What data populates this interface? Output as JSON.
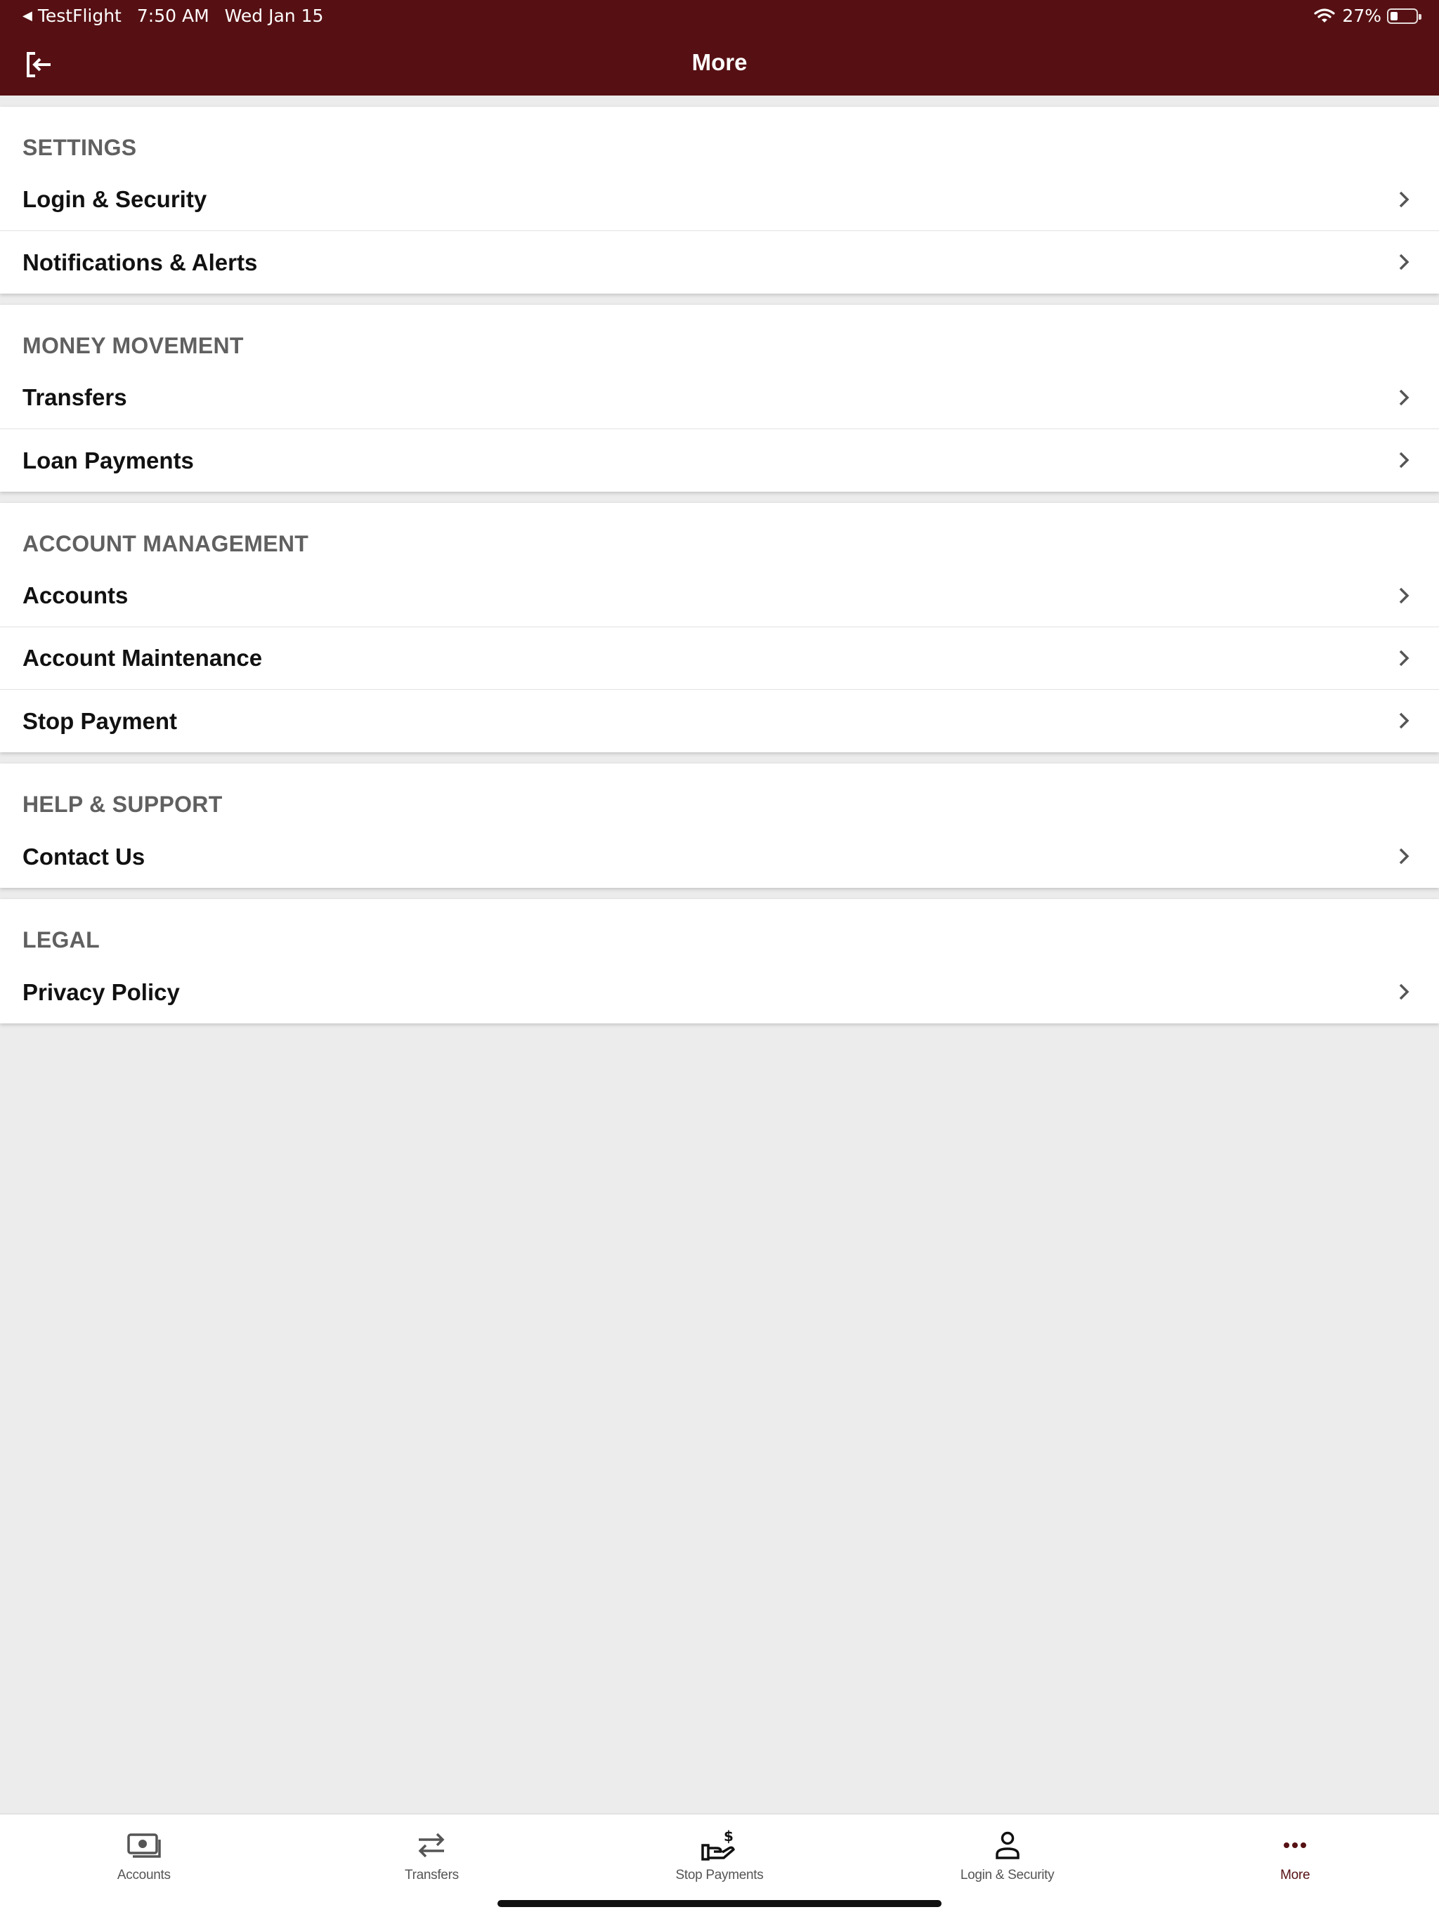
{
  "status_bar": {
    "back_app": "TestFlight",
    "time": "7:50 AM",
    "date": "Wed Jan 15",
    "battery_text": "27%",
    "battery_level": 0.27,
    "icons": [
      "back-triangle-icon",
      "wifi-icon",
      "battery-icon"
    ]
  },
  "nav": {
    "title": "More",
    "logout_icon": "logout-icon"
  },
  "sections": [
    {
      "header": "SETTINGS",
      "items": [
        {
          "label": "Login & Security"
        },
        {
          "label": "Notifications & Alerts"
        }
      ]
    },
    {
      "header": "MONEY MOVEMENT",
      "items": [
        {
          "label": "Transfers"
        },
        {
          "label": "Loan Payments"
        }
      ]
    },
    {
      "header": "ACCOUNT MANAGEMENT",
      "items": [
        {
          "label": "Accounts"
        },
        {
          "label": "Account Maintenance"
        },
        {
          "label": "Stop Payment"
        }
      ]
    },
    {
      "header": "HELP & SUPPORT",
      "items": [
        {
          "label": "Contact Us"
        }
      ]
    },
    {
      "header": "LEGAL",
      "items": [
        {
          "label": "Privacy Policy"
        }
      ]
    }
  ],
  "tabbar": {
    "tabs": [
      {
        "label": "Accounts",
        "icon": "cash-icon",
        "active": false
      },
      {
        "label": "Transfers",
        "icon": "transfer-arrows-icon",
        "active": false
      },
      {
        "label": "Stop Payments",
        "icon": "hand-dollar-icon",
        "active": false
      },
      {
        "label": "Login & Security",
        "icon": "person-icon",
        "active": false
      },
      {
        "label": "More",
        "icon": "more-dots-icon",
        "active": true
      }
    ]
  },
  "colors": {
    "brand": "#561013",
    "background": "#ececec",
    "section_header_text": "#606060",
    "row_text": "#111111",
    "chevron": "#555555",
    "tab_inactive": "#555555"
  }
}
